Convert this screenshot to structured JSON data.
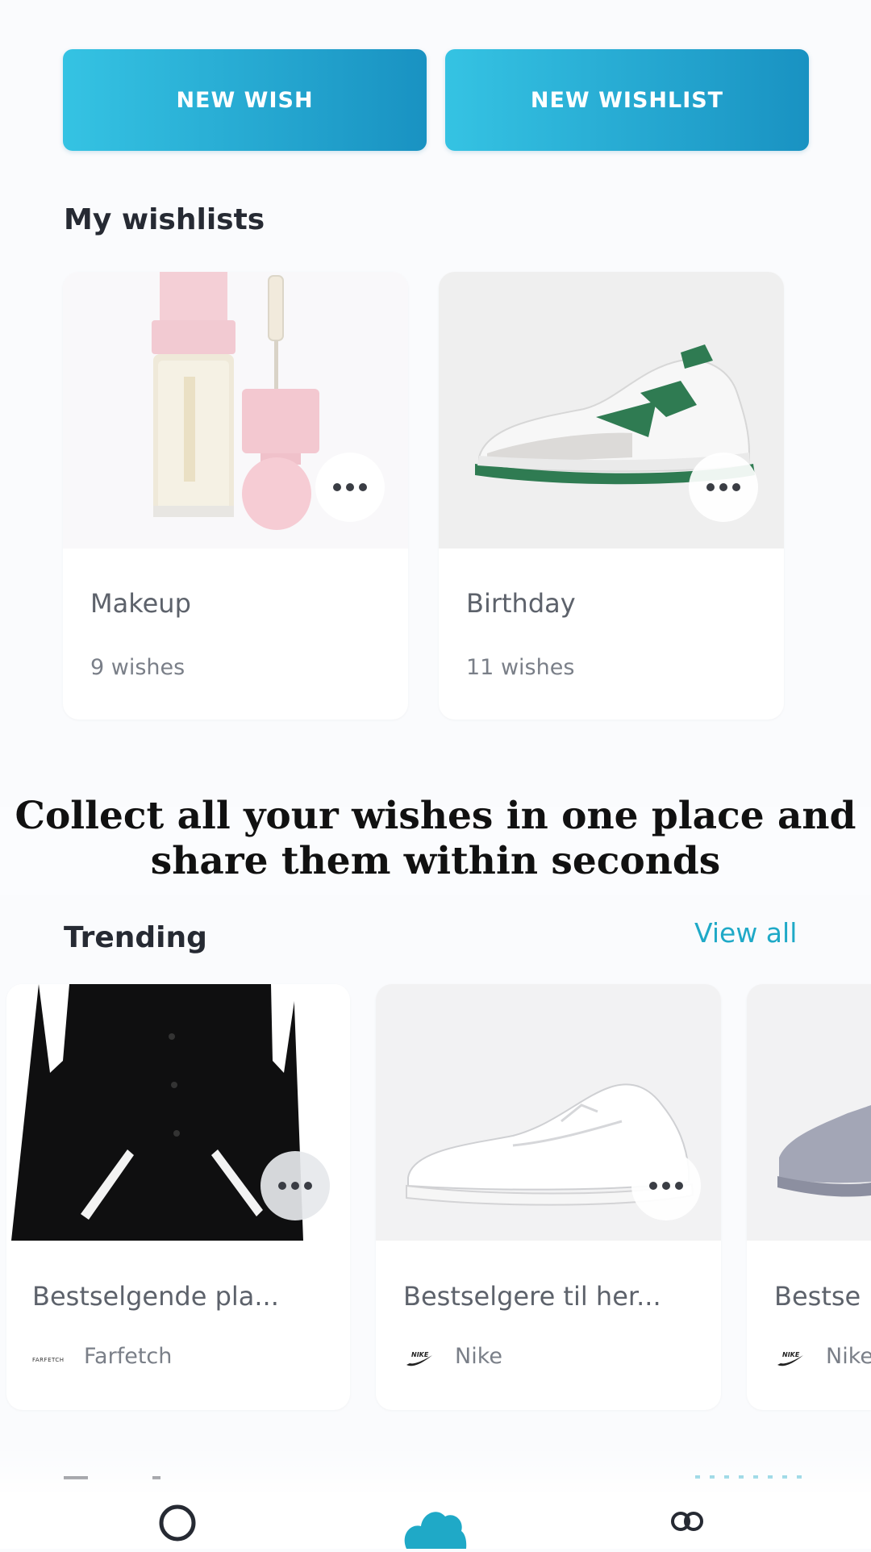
{
  "actions": {
    "new_wish": "NEW WISH",
    "new_wishlist": "NEW WISHLIST"
  },
  "my_wishlists": {
    "title": "My wishlists",
    "items": [
      {
        "name": "Makeup",
        "count": "9 wishes",
        "image": "cosmetic-bottle"
      },
      {
        "name": "Birthday",
        "count": "11 wishes",
        "image": "sneaker-green"
      }
    ]
  },
  "overlay_caption": "Collect all your wishes in one place and share them within seconds",
  "trending": {
    "title": "Trending",
    "view_all": "View all",
    "items": [
      {
        "title": "Bestselgende pla...",
        "brand": "Farfetch",
        "brand_logo_text": "FARFETCH",
        "image": "varsity-jacket"
      },
      {
        "title": "Bestselgere til her...",
        "brand": "Nike",
        "brand_logo": "nike-swoosh",
        "image": "white-sneaker"
      },
      {
        "title": "Bestse",
        "brand": "Nike",
        "brand_logo": "nike-swoosh",
        "image": "grey-sneaker"
      }
    ]
  },
  "colors": {
    "accent": "#1fa9c7",
    "button_gradient_start": "#35c3e3",
    "button_gradient_end": "#1992c2",
    "background": "#fafbfd"
  },
  "bottom_nav": {
    "items": [
      "search-icon",
      "cloud-icon",
      "friends-icon"
    ]
  }
}
